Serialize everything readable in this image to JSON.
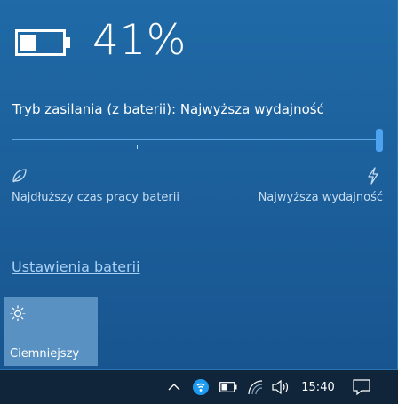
{
  "battery": {
    "percent_text": "41%",
    "level": 0.41
  },
  "power_mode": {
    "label": "Tryb zasilania (z baterii): Najwyższa wydajność",
    "slider_value": 1.0,
    "left_caption": "Najdłuższy czas pracy baterii",
    "right_caption": "Najwyższa wydajność",
    "left_icon": "leaf-icon",
    "right_icon": "lightning-bolt-icon"
  },
  "settings_link": "Ustawienia baterii",
  "quick_action": {
    "label": "Ciemniejszy",
    "icon": "brightness-sun-icon"
  },
  "taskbar": {
    "clock": "15:40",
    "icons": [
      "chevron-up-icon",
      "security-shield-icon",
      "battery-icon",
      "wifi-icon",
      "volume-icon",
      "action-center-icon"
    ]
  },
  "colors": {
    "panel_bg": "#1b5d98",
    "accent": "#4da3f0",
    "taskbar_bg": "#10243a",
    "tile_bg": "#5991c2"
  }
}
